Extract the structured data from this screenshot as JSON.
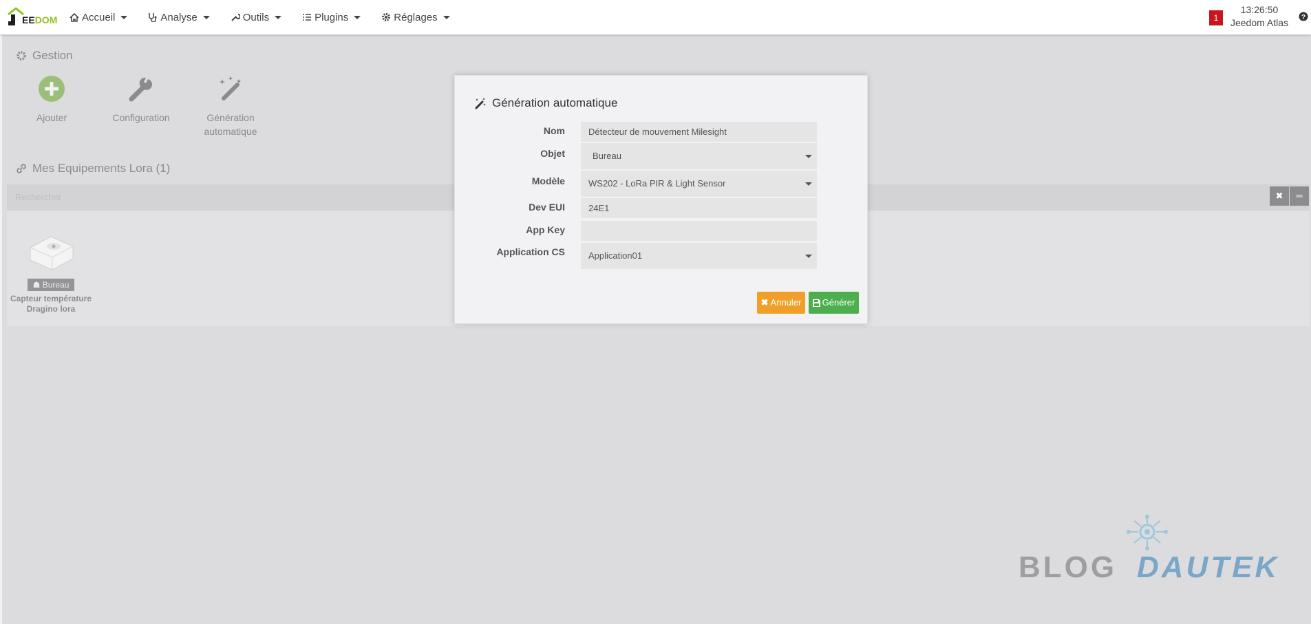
{
  "navbar": {
    "logo": {
      "j": "J",
      "text_e": "EE",
      "text_dom": "DOM"
    },
    "menu": [
      {
        "label": "Accueil",
        "icon": "home-icon"
      },
      {
        "label": "Analyse",
        "icon": "stethoscope-icon"
      },
      {
        "label": "Outils",
        "icon": "wrench-icon"
      },
      {
        "label": "Plugins",
        "icon": "list-icon"
      },
      {
        "label": "Réglages",
        "icon": "gear-icon"
      }
    ],
    "notification_count": "1",
    "time": "13:26:50",
    "user": "Jeedom Atlas",
    "help_icon": "question-icon"
  },
  "gestion": {
    "title": "Gestion",
    "items": [
      {
        "label": "Ajouter",
        "icon": "plus-circle-icon"
      },
      {
        "label": "Configuration",
        "icon": "wrench-icon"
      },
      {
        "label": "Génération automatique",
        "icon": "magic-wand-icon"
      }
    ]
  },
  "equipements": {
    "title": "Mes Equipements Lora (1)",
    "search_placeholder": "Rechercher",
    "clear_button": "✖",
    "toggle_button": "═",
    "cards": [
      {
        "badge": "Bureau",
        "name": "Capteur température Dragino lora"
      }
    ]
  },
  "modal": {
    "title": "Génération automatique",
    "fields": {
      "nom": {
        "label": "Nom",
        "value": "Détecteur de mouvement Milesight"
      },
      "objet": {
        "label": "Objet",
        "value": "Bureau"
      },
      "modele": {
        "label": "Modèle",
        "value": "WS202 - LoRa PIR & Light Sensor"
      },
      "deveui": {
        "label": "Dev EUI",
        "value": "24E1"
      },
      "appkey": {
        "label": "App Key",
        "value": ""
      },
      "appcs": {
        "label": "Application CS",
        "value": "Application01"
      }
    },
    "cancel_label": "Annuler",
    "generate_label": "Générer"
  },
  "watermark": {
    "blog": "BLOG",
    "dautek": "DAUTEK"
  },
  "colors": {
    "accent_green": "#94c11f",
    "cancel": "#f0a029",
    "generate": "#4cae4c",
    "badge_red": "#c9151e"
  }
}
